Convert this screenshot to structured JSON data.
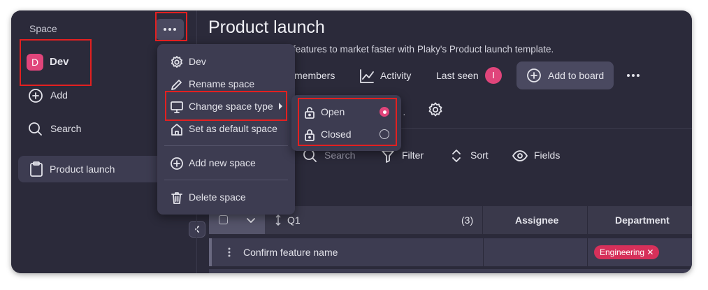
{
  "sidebar": {
    "heading": "Space",
    "space_initial": "D",
    "space_name": "Dev",
    "add_label": "Add",
    "search_label": "Search",
    "boards": [
      {
        "label": "Product launch"
      }
    ]
  },
  "header": {
    "title": "Product launch",
    "subtitle": "features to market faster with Plaky's Product launch template.",
    "members_label": "members",
    "activity_label": "Activity",
    "last_seen_label": "Last seen",
    "last_seen_initial": "I",
    "add_to_board_label": "Add to board"
  },
  "toolbar": {
    "search_label": "Search",
    "filter_label": "Filter",
    "sort_label": "Sort",
    "fields_label": "Fields"
  },
  "context_menu": {
    "items": [
      {
        "label": "Dev",
        "icon": "gear-icon"
      },
      {
        "label": "Rename space",
        "icon": "pencil-icon"
      },
      {
        "label": "Change space type",
        "icon": "monitor-icon"
      },
      {
        "label": "Set as default space",
        "icon": "home-icon"
      },
      {
        "label": "Add new space",
        "icon": "plus-circle-icon"
      },
      {
        "label": "Delete space",
        "icon": "trash-icon"
      }
    ]
  },
  "submenu": {
    "options": [
      {
        "label": "Open",
        "icon": "unlock-icon",
        "selected": true
      },
      {
        "label": "Closed",
        "icon": "lock-icon",
        "selected": false
      }
    ]
  },
  "table": {
    "group_name": "Q1",
    "group_count": "(3)",
    "columns": [
      "Assignee",
      "Department"
    ],
    "rows": [
      {
        "name": "Confirm feature name",
        "department": "Engineering"
      }
    ]
  },
  "colors": {
    "accent": "#e0457b",
    "background": "#2b2a3a",
    "menu": "#3d3c51",
    "highlight": "#e32020"
  }
}
